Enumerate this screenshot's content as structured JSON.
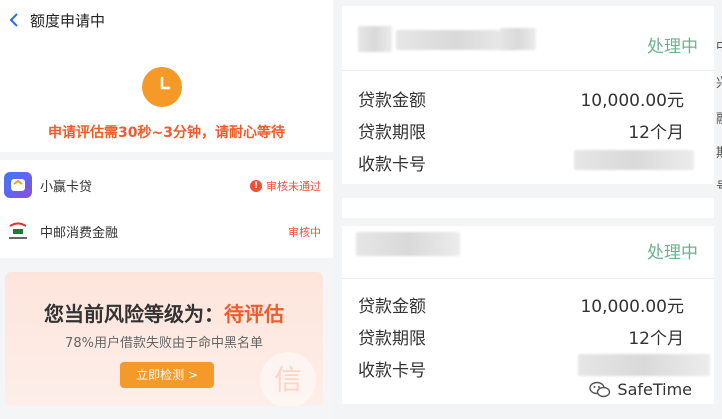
{
  "left": {
    "header": {
      "title": "额度申请中"
    },
    "status": {
      "text": "申请评估需30秒~3分钟，请耐心等待"
    },
    "apps": [
      {
        "name": "小赢卡贷",
        "status": "审核未通过",
        "warn": "!"
      },
      {
        "name": "中邮消费金融",
        "status": "审核中"
      }
    ],
    "risk": {
      "prefix": "您当前风险等级为：",
      "level": "待评估",
      "note": "78%用户借款失败由于命中黑名单",
      "button": "立即检测 >",
      "watermark_glyph": "信"
    }
  },
  "right": {
    "cards": [
      {
        "status": "处理中",
        "rows": [
          {
            "label": "贷款金额",
            "value": "10,000.00元"
          },
          {
            "label": "贷款期限",
            "value": "12个月"
          },
          {
            "label": "收款卡号",
            "value": ""
          }
        ]
      },
      {
        "status": "处理中",
        "rows": [
          {
            "label": "贷款金额",
            "value": "10,000.00元"
          },
          {
            "label": "贷款期限",
            "value": "12个月"
          },
          {
            "label": "收款卡号",
            "value": ""
          }
        ]
      }
    ],
    "edge_glyphs": [
      "中",
      "兴",
      "融",
      "期",
      "号"
    ],
    "watermark": "SafeTime"
  },
  "colors": {
    "accent_orange": "#f59a26",
    "alert_red": "#ef5b2b",
    "processing_green": "#6bb48e"
  },
  "icons": {
    "back": "chevron-left-icon",
    "clock": "clock-icon",
    "warn": "warning-icon",
    "wechat": "wechat-icon"
  }
}
